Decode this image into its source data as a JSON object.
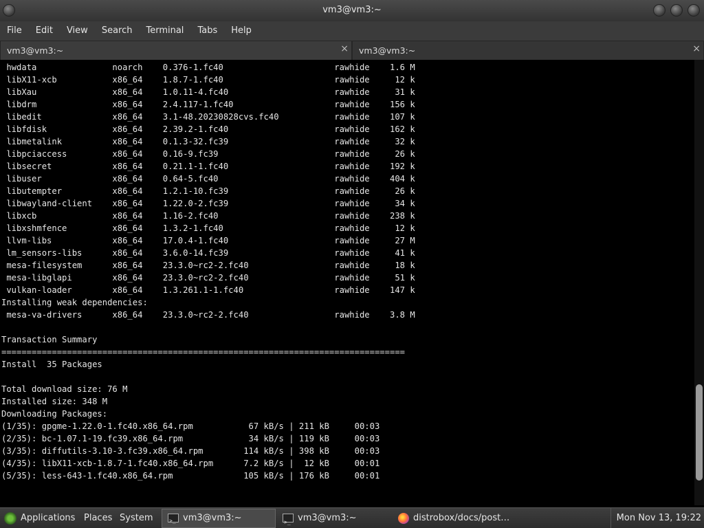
{
  "window": {
    "title": "vm3@vm3:~"
  },
  "menu": [
    "File",
    "Edit",
    "View",
    "Search",
    "Terminal",
    "Tabs",
    "Help"
  ],
  "tabs": [
    {
      "label": "vm3@vm3:~",
      "close": "×"
    },
    {
      "label": "vm3@vm3:~",
      "close": "×"
    }
  ],
  "terminal": {
    "lines": [
      " hwdata               noarch    0.376-1.fc40                      rawhide    1.6 M",
      " libX11-xcb           x86_64    1.8.7-1.fc40                      rawhide     12 k",
      " libXau               x86_64    1.0.11-4.fc40                     rawhide     31 k",
      " libdrm               x86_64    2.4.117-1.fc40                    rawhide    156 k",
      " libedit              x86_64    3.1-48.20230828cvs.fc40           rawhide    107 k",
      " libfdisk             x86_64    2.39.2-1.fc40                     rawhide    162 k",
      " libmetalink          x86_64    0.1.3-32.fc39                     rawhide     32 k",
      " libpciaccess         x86_64    0.16-9.fc39                       rawhide     26 k",
      " libsecret            x86_64    0.21.1-1.fc40                     rawhide    192 k",
      " libuser              x86_64    0.64-5.fc40                       rawhide    404 k",
      " libutempter          x86_64    1.2.1-10.fc39                     rawhide     26 k",
      " libwayland-client    x86_64    1.22.0-2.fc39                     rawhide     34 k",
      " libxcb               x86_64    1.16-2.fc40                       rawhide    238 k",
      " libxshmfence         x86_64    1.3.2-1.fc40                      rawhide     12 k",
      " llvm-libs            x86_64    17.0.4-1.fc40                     rawhide     27 M",
      " lm_sensors-libs      x86_64    3.6.0-14.fc39                     rawhide     41 k",
      " mesa-filesystem      x86_64    23.3.0~rc2-2.fc40                 rawhide     18 k",
      " mesa-libglapi        x86_64    23.3.0~rc2-2.fc40                 rawhide     51 k",
      " vulkan-loader        x86_64    1.3.261.1-1.fc40                  rawhide    147 k",
      "Installing weak dependencies:",
      " mesa-va-drivers      x86_64    23.3.0~rc2-2.fc40                 rawhide    3.8 M",
      "",
      "Transaction Summary",
      "================================================================================",
      "Install  35 Packages",
      "",
      "Total download size: 76 M",
      "Installed size: 348 M",
      "Downloading Packages:",
      "(1/35): gpgme-1.22.0-1.fc40.x86_64.rpm           67 kB/s | 211 kB     00:03",
      "(2/35): bc-1.07.1-19.fc39.x86_64.rpm             34 kB/s | 119 kB     00:03",
      "(3/35): diffutils-3.10-3.fc39.x86_64.rpm        114 kB/s | 398 kB     00:03",
      "(4/35): libX11-xcb-1.8.7-1.fc40.x86_64.rpm      7.2 kB/s |  12 kB     00:01",
      "(5/35): less-643-1.fc40.x86_64.rpm              105 kB/s | 176 kB     00:01"
    ],
    "scroll_position": 0.93
  },
  "taskbar": {
    "applications": "Applications",
    "places": "Places",
    "system": "System",
    "tasks": [
      "vm3@vm3:~",
      "vm3@vm3:~",
      "distrobox/docs/post…"
    ],
    "clock": "Mon Nov 13, 19:22"
  }
}
